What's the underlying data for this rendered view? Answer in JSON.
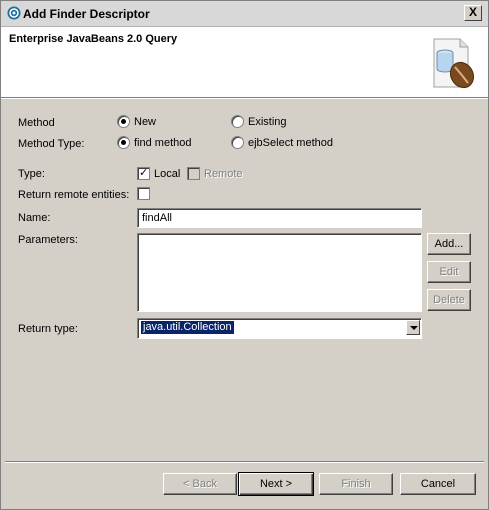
{
  "window": {
    "title": "Add Finder Descriptor",
    "close_glyph": "X"
  },
  "header": {
    "title": "Enterprise JavaBeans 2.0 Query"
  },
  "form": {
    "method_label": "Method",
    "method_new": "New",
    "method_existing": "Existing",
    "method_selected": "New",
    "method_type_label": "Method Type:",
    "method_type_find": "find method",
    "method_type_ejbselect": "ejbSelect method",
    "method_type_selected": "find method",
    "type_label": "Type:",
    "type_local": "Local",
    "type_local_checked": true,
    "type_remote": "Remote",
    "type_remote_enabled": false,
    "return_remote_label": "Return remote entities:",
    "return_remote_checked": false,
    "name_label": "Name:",
    "name_value": "findAll",
    "parameters_label": "Parameters:",
    "add_button": "Add...",
    "edit_button": "Edit",
    "delete_button": "Delete",
    "return_type_label": "Return type:",
    "return_type_value": "java.util.Collection"
  },
  "footer": {
    "back_button": "< Back",
    "next_button": "Next >",
    "finish_button": "Finish",
    "cancel_button": "Cancel"
  },
  "icons": {
    "window": "eclipse-icon",
    "header": "ejb-bean-icon"
  }
}
